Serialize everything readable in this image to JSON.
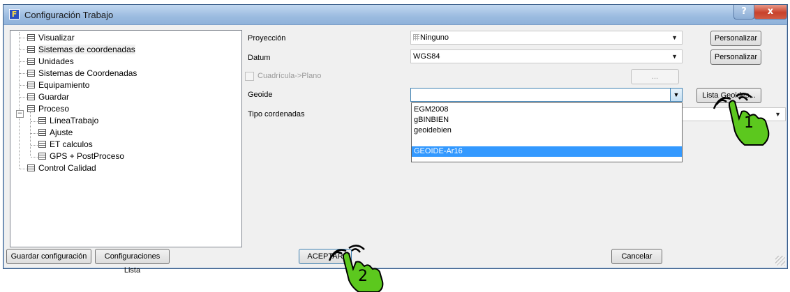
{
  "window": {
    "title": "Configuración Trabajo",
    "help_label": "?",
    "close_label": "x"
  },
  "tree": {
    "items": [
      {
        "label": "Visualizar"
      },
      {
        "label": "Sistemas de coordenadas"
      },
      {
        "label": "Unidades"
      },
      {
        "label": "Sistemas de Coordenadas"
      },
      {
        "label": "Equipamiento"
      },
      {
        "label": "Guardar"
      },
      {
        "label": "Proceso"
      },
      {
        "label": "LíneaTrabajo"
      },
      {
        "label": "Ajuste"
      },
      {
        "label": "ET calculos"
      },
      {
        "label": "GPS + PostProceso"
      },
      {
        "label": "Control Calidad"
      }
    ],
    "proceso_expander": "−"
  },
  "form": {
    "proyeccion_label": "Proyección",
    "proyeccion_value": "Ninguno",
    "datum_label": "Datum",
    "datum_value": "WGS84",
    "cuadricula_label": "Cuadrícula->Plano",
    "ellipsis_label": "...",
    "geoide_label": "Geoide",
    "geoide_value": "",
    "tipo_label": "Tipo cordenadas",
    "personalizar_1": "Personalizar",
    "personalizar_2": "Personalizar",
    "lista_geoides": "Lista Geoides..."
  },
  "geoide_options": [
    "EGM2008",
    "gBINBIEN",
    "geoidebien",
    "",
    "GEOIDE-Ar16"
  ],
  "footer": {
    "guardar_config": "Guardar configuración",
    "config_lista": "Configuraciones Lista",
    "aceptar": "ACEPTAR",
    "cancelar": "Cancelar"
  },
  "annotations": {
    "step1": "1",
    "step2": "2"
  },
  "colors": {
    "title_gradient": "#9bbbe0",
    "highlight": "#3399ff",
    "close": "#c8412b",
    "hand_green": "#5cc81e"
  }
}
